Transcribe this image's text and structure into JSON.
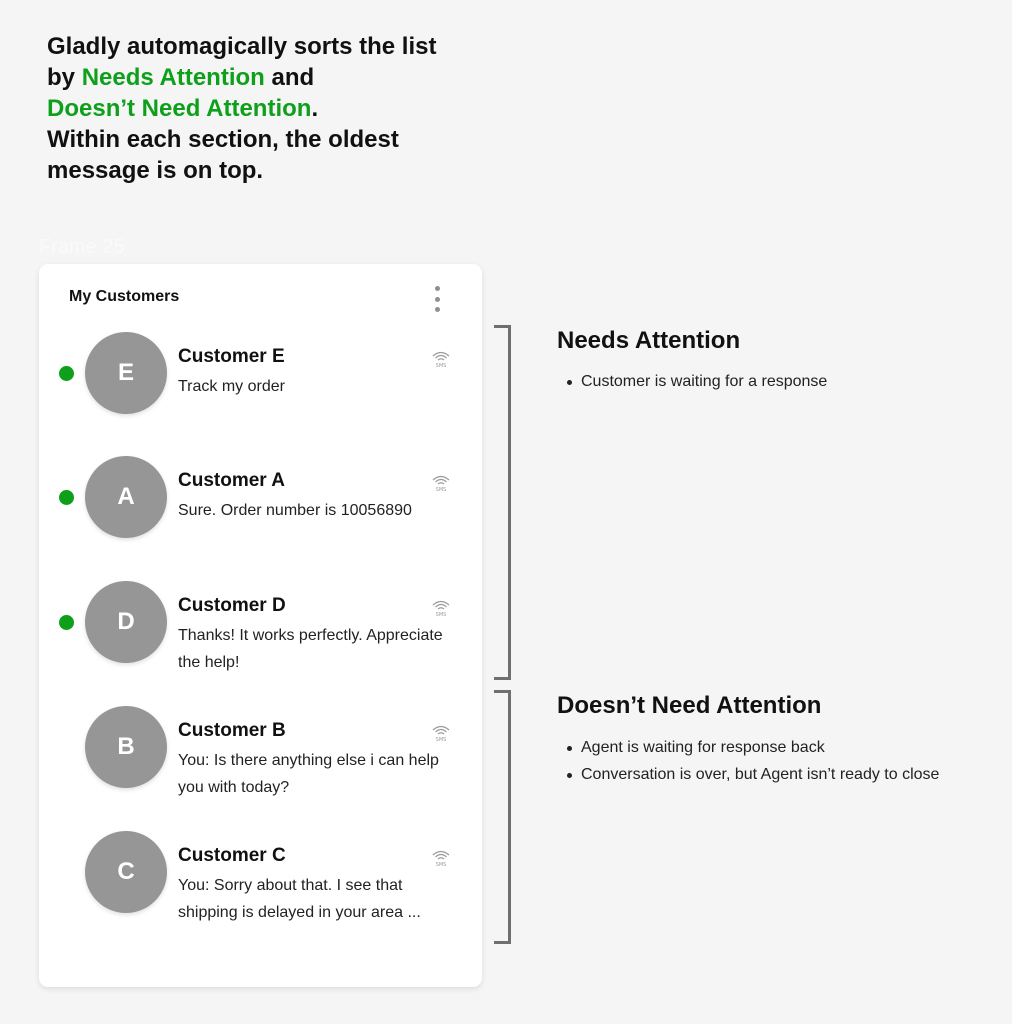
{
  "intro": {
    "line1": "Gladly automagically sorts the list",
    "line2_prefix": "by ",
    "line2_highlight": "Needs Attention",
    "line2_suffix": " and",
    "line3_highlight": "Doesn’t Need Attention",
    "line3_suffix": ".",
    "line4": "Within each section, the oldest",
    "line5": "message is on top."
  },
  "frame_label": "Frame 25",
  "panel": {
    "title": "My Customers",
    "menu_icon": "more-vertical-icon",
    "channel_icon": "sms-icon",
    "channel_label": "SMS",
    "customers": [
      {
        "initial": "E",
        "name": "Customer E",
        "message": "Track my order",
        "needs_attention": true
      },
      {
        "initial": "A",
        "name": "Customer A",
        "message": "Sure. Order number is 10056890",
        "needs_attention": true
      },
      {
        "initial": "D",
        "name": "Customer D",
        "message": "Thanks! It works perfectly. Appreciate the help!",
        "needs_attention": true
      },
      {
        "initial": "B",
        "name": "Customer B",
        "message": "You: Is there anything else i can help you with today?",
        "needs_attention": false
      },
      {
        "initial": "C",
        "name": "Customer C",
        "message": "You: Sorry about that. I see that shipping is delayed in your area ...",
        "needs_attention": false
      }
    ]
  },
  "sections": [
    {
      "title": "Needs Attention",
      "bullets": [
        "Customer is waiting for a response"
      ]
    },
    {
      "title": "Doesn’t Need Attention",
      "bullets": [
        "Agent is waiting for response back",
        "Conversation is over, but Agent isn’t ready to close"
      ]
    }
  ],
  "colors": {
    "accent_green": "#0ea01a",
    "avatar_gray": "#969696",
    "bracket_gray": "#6f6f6f",
    "background": "#f5f5f5"
  }
}
